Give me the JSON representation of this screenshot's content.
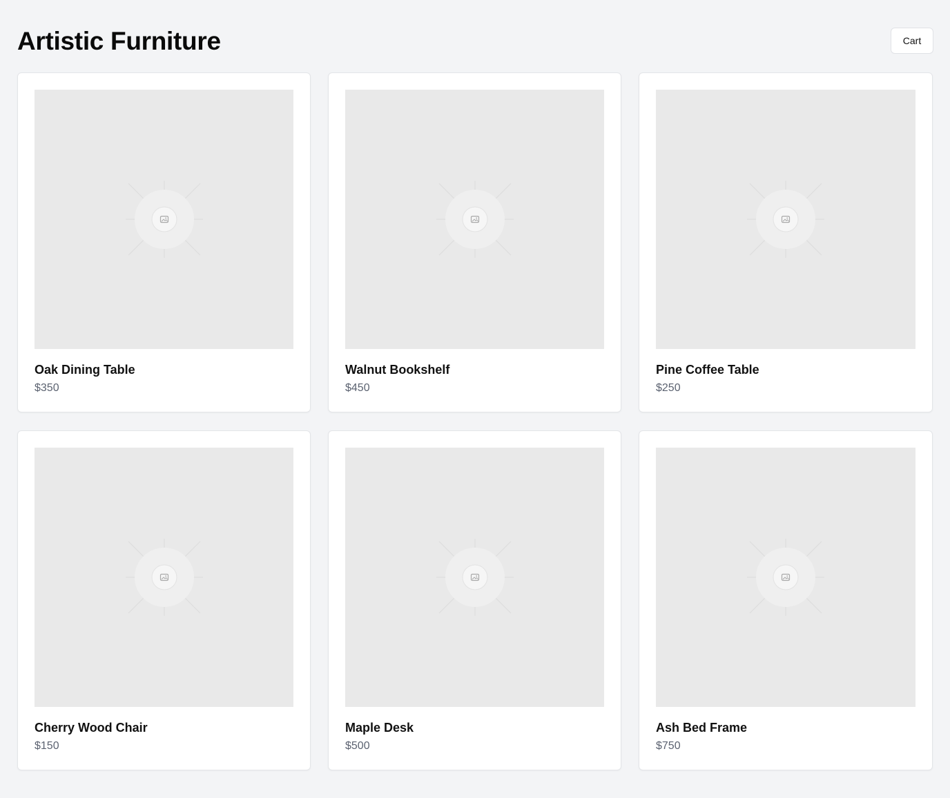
{
  "header": {
    "title": "Artistic Furniture",
    "cart_label": "Cart"
  },
  "products": [
    {
      "name": "Oak Dining Table",
      "price": "$350"
    },
    {
      "name": "Walnut Bookshelf",
      "price": "$450"
    },
    {
      "name": "Pine Coffee Table",
      "price": "$250"
    },
    {
      "name": "Cherry Wood Chair",
      "price": "$150"
    },
    {
      "name": "Maple Desk",
      "price": "$500"
    },
    {
      "name": "Ash Bed Frame",
      "price": "$750"
    }
  ],
  "colors": {
    "page_background": "#f3f4f6",
    "card_background": "#ffffff",
    "image_placeholder": "#e9e9e9",
    "price_text": "#5b6270"
  },
  "icons": {
    "product_image": "image-placeholder-icon"
  }
}
